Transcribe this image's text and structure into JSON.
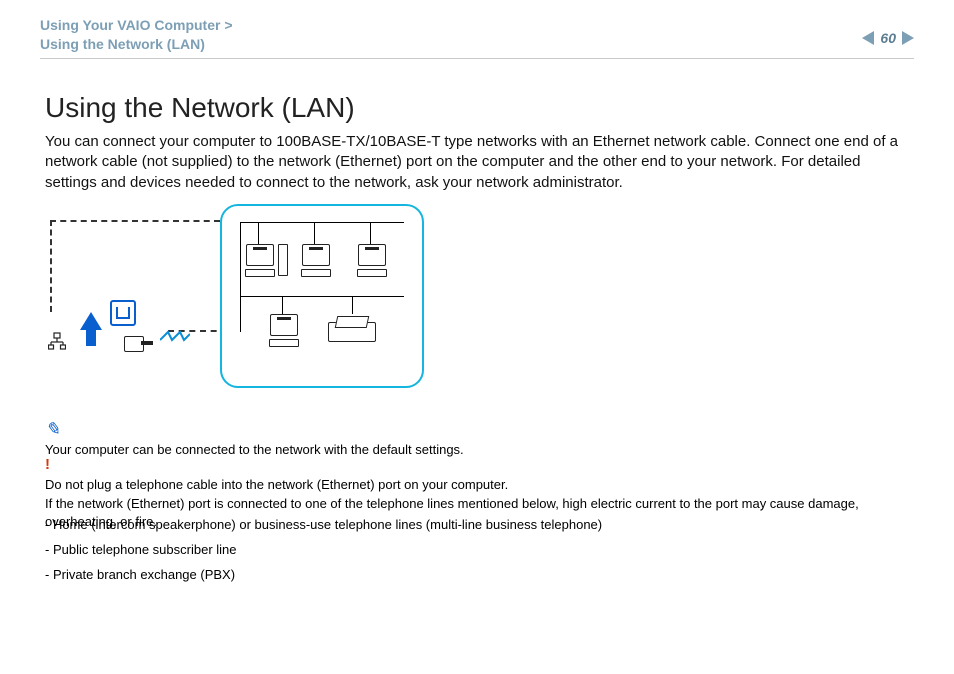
{
  "header": {
    "breadcrumb_parent": "Using Your VAIO Computer",
    "breadcrumb_sep": ">",
    "breadcrumb_current": "Using the Network (LAN)",
    "page_number": "60"
  },
  "title": "Using the Network (LAN)",
  "intro": "You can connect your computer to 100BASE-TX/10BASE-T type networks with an Ethernet network cable. Connect one end of a network cable (not supplied) to the network (Ethernet) port on the computer and the other end to your network. For detailed settings and devices needed to connect to the network, ask your network administrator.",
  "note_tip": "Your computer can be connected to the network with the default settings.",
  "note_warn_line1": "Do not plug a telephone cable into the network (Ethernet) port on your computer.",
  "note_warn_line2": "If the network (Ethernet) port is connected to one of the telephone lines mentioned below, high electric current to the port may cause damage, overheating, or fire.",
  "warn_items": [
    "- Home (intercom speakerphone) or business-use telephone lines (multi-line business telephone)",
    "- Public telephone subscriber line",
    "- Private branch exchange (PBX)"
  ],
  "icons": {
    "tip": "✎",
    "warn": "!",
    "network_small": "⧈"
  }
}
